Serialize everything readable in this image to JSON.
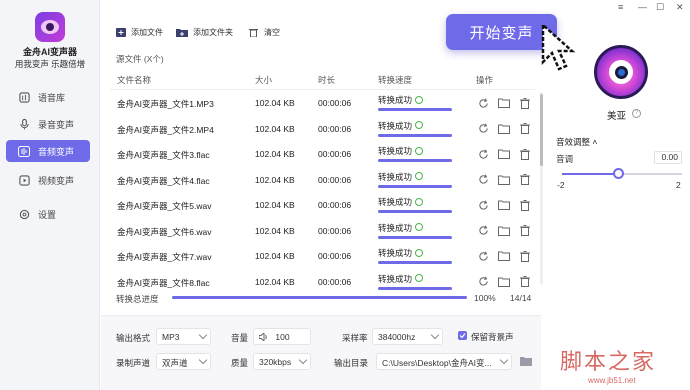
{
  "app": {
    "name": "金舟AI变声器",
    "slogan": "用我变声 乐趣倍增"
  },
  "nav": [
    {
      "label": "语音库",
      "icon": "voice-library-icon",
      "active": false
    },
    {
      "label": "录音变声",
      "icon": "microphone-icon",
      "active": false
    },
    {
      "label": "音频变声",
      "icon": "audio-wave-icon",
      "active": true
    },
    {
      "label": "视频变声",
      "icon": "video-icon",
      "active": false
    },
    {
      "label": "设置",
      "icon": "gear-icon",
      "active": false
    }
  ],
  "toolbar": {
    "add_file": "添加文件",
    "add_folder": "添加文件夹",
    "clear": "清空"
  },
  "source_label": "源文件 (X个)",
  "table": {
    "headers": {
      "name": "文件名称",
      "size": "大小",
      "duration": "时长",
      "speed": "转换速度",
      "ops": "操作"
    },
    "rows": [
      {
        "name": "金舟AI变声器_文件1.MP3",
        "size": "102.04 KB",
        "duration": "00:00:06",
        "status": "转换成功"
      },
      {
        "name": "金舟AI变声器_文件2.MP4",
        "size": "102.04 KB",
        "duration": "00:00:06",
        "status": "转换成功"
      },
      {
        "name": "金舟AI变声器_文件3.flac",
        "size": "102.04 KB",
        "duration": "00:00:06",
        "status": "转换成功"
      },
      {
        "name": "金舟AI变声器_文件4.flac",
        "size": "102.04 KB",
        "duration": "00:00:06",
        "status": "转换成功"
      },
      {
        "name": "金舟AI变声器_文件5.wav",
        "size": "102.04 KB",
        "duration": "00:00:06",
        "status": "转换成功"
      },
      {
        "name": "金舟AI变声器_文件6.wav",
        "size": "102.04 KB",
        "duration": "00:00:06",
        "status": "转换成功"
      },
      {
        "name": "金舟AI变声器_文件7.wav",
        "size": "102.04 KB",
        "duration": "00:00:06",
        "status": "转换成功"
      },
      {
        "name": "金舟AI变声器_文件8.flac",
        "size": "102.04 KB",
        "duration": "00:00:06",
        "status": "转换成功"
      }
    ]
  },
  "progress": {
    "label": "转换总进度",
    "percent_text": "100%",
    "fraction": 1.0,
    "count": "14/14"
  },
  "settings": {
    "output_format_label": "输出格式",
    "output_format": "MP3",
    "volume_label": "音量",
    "volume": "100",
    "sample_rate_label": "采样率",
    "sample_rate": "384000hz",
    "keep_bg_label": "保留背景声",
    "keep_bg": true,
    "channel_label": "录制声道",
    "channel": "双声道",
    "quality_label": "质量",
    "quality": "320kbps",
    "output_dir_label": "输出目录",
    "output_dir": "C:\\Users\\Desktop\\金舟AI变..."
  },
  "start_button": "开始变声",
  "right_panel": {
    "voice_name": "美亚",
    "section_title": "音效调整 ˄",
    "pitch_label": "音调",
    "pitch_value": "0.00",
    "pitch_min": "-2",
    "pitch_max": "2",
    "pitch_level": 0.5
  },
  "window_controls": {
    "menu": "≡",
    "minimize": "—",
    "maximize": "☐",
    "close": "✕"
  },
  "watermark": {
    "text": "脚本之家",
    "url": "www.jb51.net"
  },
  "colors": {
    "accent": "#6e6ae8",
    "success": "#4cb34c"
  }
}
